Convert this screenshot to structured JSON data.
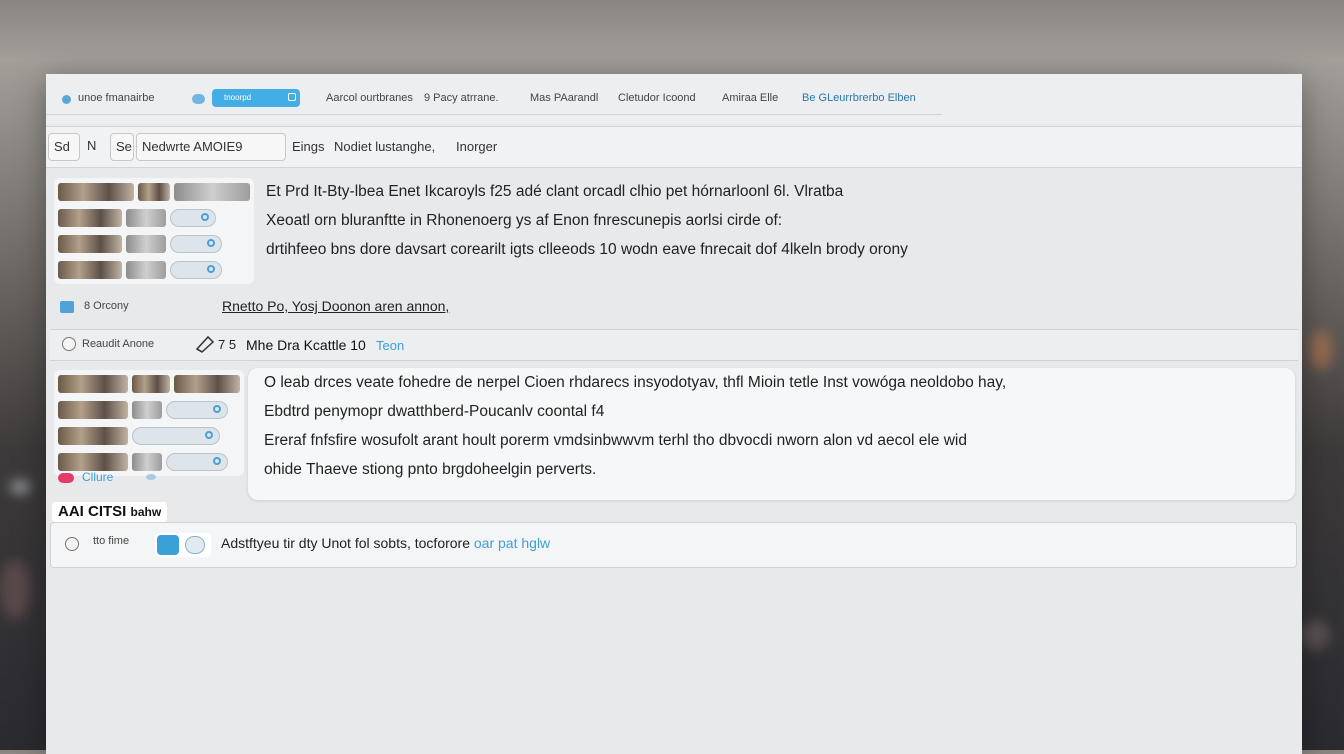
{
  "topbar": {
    "app_label": "unoe fmanairbe",
    "search_pill": "tnoorpd",
    "items": [
      "Aarcol ourtbranes",
      "9 Pacy atrrane.",
      "Mas PAarandl",
      "Cletudor Icoond",
      "Amiraa Elle",
      "Be GLeurrbrerbo Elben"
    ]
  },
  "toolbar": {
    "btn1": "Sd",
    "btn2": "N",
    "btn3": "Se",
    "title": "Nedwrte AMOIE9",
    "items": [
      "Eings",
      "Nodiet lustanghe,",
      "Inorger"
    ]
  },
  "message1": {
    "lines": [
      "Et Prd It-Bty-lbea Enet Ikcaroyls f25 adé clant orcadl clhio pet hórnarloonl 6l. Vlratba",
      "Xeoatl orn bluranftte in Rhonenoerg ys af Enon fnrescunepis aorlsi cirde of:",
      "drtihfeeo bns dore davsart corearilt igts clleeods 10 wodn eave fnrecait dof 4lkeln brody orony"
    ]
  },
  "section1": {
    "label": "8 Orcony",
    "link_text": "Rnetto Po, Yosj Doonon aren annon,"
  },
  "section_bar": {
    "label": "Reaudit Anone",
    "title": "Mhe Dra Kcattle 10",
    "count_prefix": "7 5",
    "link": "Teon"
  },
  "message2": {
    "lines": [
      "O leab drces veate fohedre de nerpel Cioen rhdarecs insyodotyav, thfl Mioin tetle Inst vowóga neoldobo hay,",
      "Ebdtrd penymopr dwatthberd-Poucanlv coontal f4",
      "Ereraf fnfsfire wosufolt arant hoult porerm vmdsinbwwvm terhl tho dbvocdi nworn alon vd aecol ele wid",
      "ohide Thaeve stiong pnto brgdoheelgin perverts."
    ]
  },
  "section2": {
    "label": "Cllure"
  },
  "ai_panel": {
    "label": "AAI CITSI",
    "sublabel": "bahw",
    "bottom_label": "tto fime",
    "input_text": "Adstftyeu tir dty Unot fol sobts, tocforore",
    "input_link": "oar pat hglw"
  },
  "colors": {
    "accent": "#43aee6",
    "window_bg": "#e8e9eb",
    "card_bg": "#f6f7f8"
  }
}
